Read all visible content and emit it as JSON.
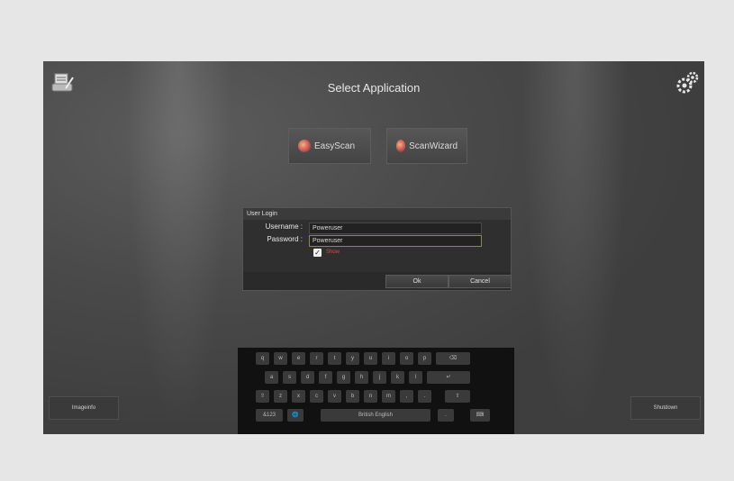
{
  "header": {
    "title": "Select Application"
  },
  "apps": [
    {
      "label": "EasyScan"
    },
    {
      "label": "ScanWizard"
    }
  ],
  "icons": {
    "left_corner": "scanner-document-icon",
    "right_corner": "settings-gears-icon"
  },
  "dialog": {
    "title": "User Login",
    "username_label": "Username :",
    "username_value": "Poweruser",
    "password_label": "Password :",
    "password_value": "Poweruser",
    "checkbox_label": "Show",
    "checkbox_checked": true,
    "ok_label": "Ok",
    "cancel_label": "Cancel"
  },
  "keyboard": {
    "row1": [
      "q",
      "w",
      "e",
      "r",
      "t",
      "y",
      "u",
      "i",
      "o",
      "p",
      "⌫"
    ],
    "row2": [
      "a",
      "s",
      "d",
      "f",
      "g",
      "h",
      "j",
      "k",
      "l",
      "↵"
    ],
    "row3": [
      "⇧",
      "z",
      "x",
      "c",
      "v",
      "b",
      "n",
      "m",
      ",",
      ".",
      "⇧"
    ],
    "row4": {
      "numbers": "&123",
      "globe": "🌐",
      "space": "British English",
      "period": ".",
      "hide": "⌨"
    }
  },
  "footer": {
    "left_button": "Imageinfo",
    "right_button": "Shutdown"
  }
}
